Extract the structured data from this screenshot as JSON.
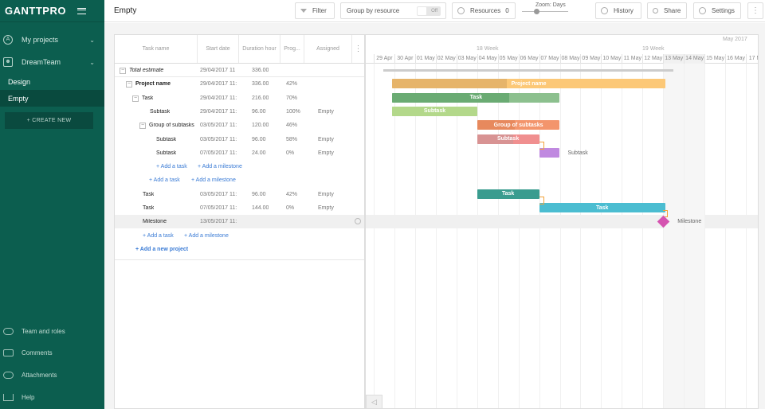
{
  "sidebar": {
    "logo": "GANTTPRO",
    "menu_label": "My projects",
    "team_name": "DreamTeam",
    "projects": [
      "Design",
      "Empty"
    ],
    "create_label": "+ CREATE NEW",
    "bottom": [
      "Team and roles",
      "Comments",
      "Attachments",
      "Help"
    ]
  },
  "topbar": {
    "title": "Empty",
    "filter": "Filter",
    "group_by": "Group by resource",
    "toggle": "Off",
    "resources": "Resources",
    "resources_count": "0",
    "zoom": "Zoom: Days",
    "history": "History",
    "share": "Share",
    "settings": "Settings"
  },
  "grid": {
    "columns": [
      "Task name",
      "Start date",
      "Duration hour",
      "Prog...",
      "Assigned"
    ],
    "rows": [
      {
        "name": "Total estimate",
        "start": "29/04/2017 11",
        "dur": "336.00",
        "prog": "",
        "assigned": ""
      },
      {
        "name": "Project name",
        "start": "29/04/2017 11:",
        "dur": "336.00",
        "prog": "42%",
        "assigned": ""
      },
      {
        "name": "Task",
        "start": "29/04/2017 11:",
        "dur": "216.00",
        "prog": "70%",
        "assigned": ""
      },
      {
        "name": "Subtask",
        "start": "29/04/2017 11:",
        "dur": "96.00",
        "prog": "100%",
        "assigned": "Empty"
      },
      {
        "name": "Group of subtasks",
        "start": "03/05/2017 11:",
        "dur": "120.00",
        "prog": "46%",
        "assigned": ""
      },
      {
        "name": "Subtask",
        "start": "03/05/2017 11:",
        "dur": "96.00",
        "prog": "58%",
        "assigned": "Empty"
      },
      {
        "name": "Subtask",
        "start": "07/05/2017 11:",
        "dur": "24.00",
        "prog": "0%",
        "assigned": "Empty"
      },
      {
        "name": "",
        "start": "",
        "dur": "",
        "prog": "",
        "assigned": ""
      },
      {
        "name": "",
        "start": "",
        "dur": "",
        "prog": "",
        "assigned": ""
      },
      {
        "name": "Task",
        "start": "03/05/2017 11:",
        "dur": "96.00",
        "prog": "42%",
        "assigned": "Empty"
      },
      {
        "name": "Task",
        "start": "07/05/2017 11:",
        "dur": "144.00",
        "prog": "0%",
        "assigned": "Empty"
      },
      {
        "name": "Milestone",
        "start": "13/05/2017 11:",
        "dur": "",
        "prog": "",
        "assigned": ""
      }
    ],
    "add_task": "+ Add a task",
    "add_milestone": "+ Add a milestone",
    "add_project": "+ Add a new project"
  },
  "timeline": {
    "month": "May 2017",
    "weeks": [
      "18 Week",
      "19 Week"
    ],
    "days": [
      "r",
      "29 Apr",
      "30 Apr",
      "01 May",
      "02 May",
      "03 May",
      "04 May",
      "05 May",
      "06 May",
      "07 May",
      "08 May",
      "09 May",
      "10 May",
      "11 May",
      "12 May",
      "13 May",
      "14 May",
      "15 May",
      "16 May",
      "17 Ma"
    ],
    "bars": [
      {
        "label": "Project name",
        "progress": 42,
        "color": "#fcc877",
        "prog_color": "#e6b46a"
      },
      {
        "label": "Task",
        "progress": 70,
        "color": "#8cc08e",
        "prog_color": "#6aab73"
      },
      {
        "label": "Subtask",
        "progress": 100,
        "color": "#b3d88a",
        "prog_color": "#b3d88a"
      },
      {
        "label": "Group of subtasks",
        "progress": 46,
        "color": "#f3956c",
        "prog_color": "#e7895d"
      },
      {
        "label": "Subtask",
        "progress": 58,
        "color": "#f08f8f",
        "prog_color": "#d89393"
      },
      {
        "label": "",
        "progress": 0,
        "color": "#c089e0",
        "prog_color": "#c089e0"
      },
      {
        "label": "Task",
        "progress": 42,
        "color": "#3a9c8f",
        "prog_color": "#3a9c8f"
      },
      {
        "label": "Task",
        "progress": 0,
        "color": "#4bbdd1",
        "prog_color": "#4bbdd1"
      }
    ],
    "side_labels": [
      "Subtask",
      "Milestone"
    ]
  },
  "colors": {
    "sidebar_bg": "#0c5e4f",
    "milestone": "#d553b0",
    "link": "#f2a23a"
  }
}
